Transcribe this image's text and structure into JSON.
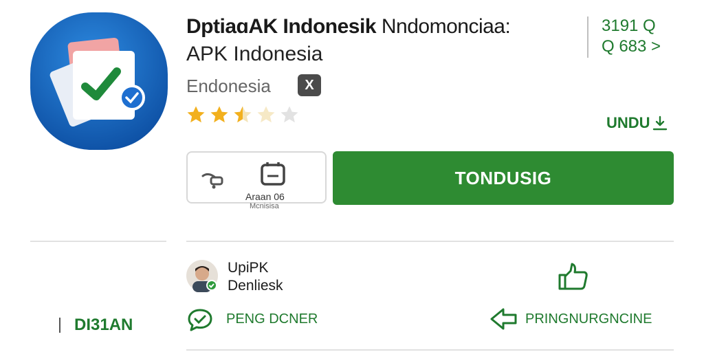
{
  "app": {
    "title_bold": "DptiaɑAK Indonesik",
    "title_light": "Nndomonciaa:",
    "subtitle": "APK Indonesia",
    "publisher": "Endonesia",
    "publisher_badge": "X",
    "rating_stars": 2.5,
    "rating_max": 5
  },
  "stats": {
    "line1": "3191 Q",
    "line2": "Q 683 >",
    "unduh_label": "UNDU"
  },
  "actions": {
    "info_label": "Araan 06",
    "info_sublabel": "Mcnisisa",
    "install_label": "TONDUSIG"
  },
  "developer": {
    "name_line1": "UpiPK",
    "name_line2": "Denliesk"
  },
  "bottom": {
    "side_label": "DI31AN",
    "link1": "PENG DCNER",
    "link2": "PRINGNURGNCINE"
  },
  "colors": {
    "accent": "#2e8b32",
    "accent_text": "#1f7a2e",
    "icon_blue": "#1565c0",
    "star": "#f2b01e"
  },
  "icons": {
    "share": "share-icon",
    "device": "device-icon",
    "thumb": "thumbs-up-icon",
    "chat": "chat-icon",
    "arrow": "arrow-icon",
    "download": "download-icon"
  }
}
